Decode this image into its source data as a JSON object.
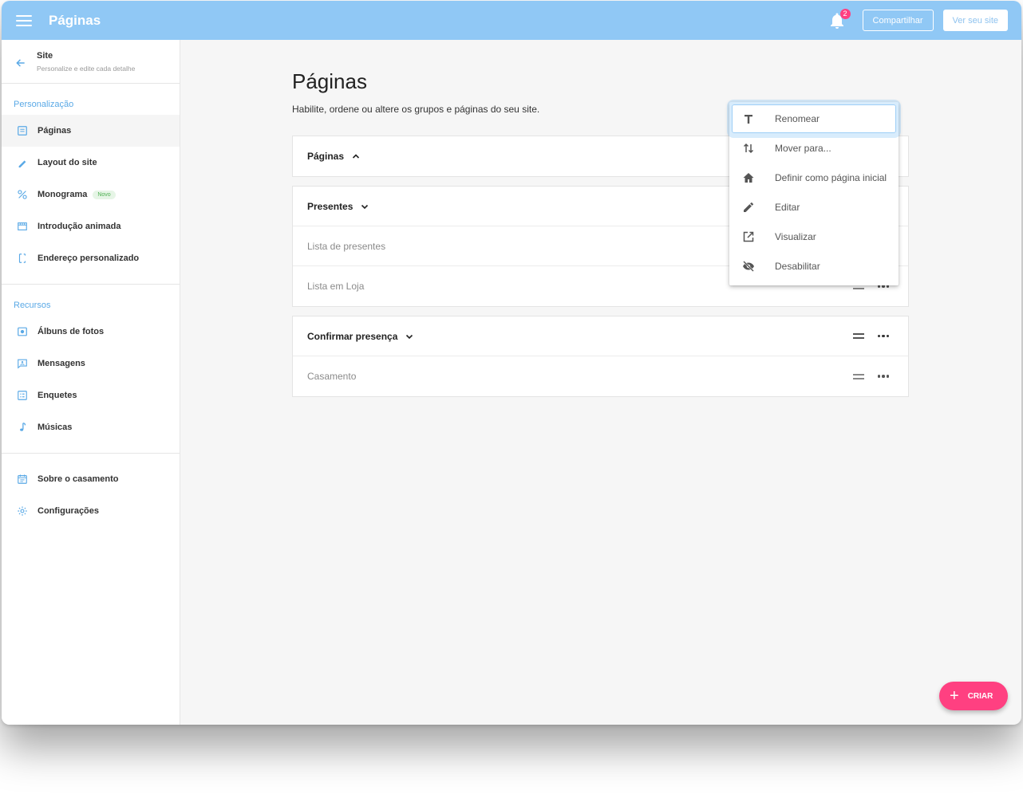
{
  "header": {
    "title": "Páginas",
    "notification_count": "2",
    "share_label": "Compartilhar",
    "view_site_label": "Ver seu site"
  },
  "sidebar": {
    "header_title": "Site",
    "header_subtitle": "Personalize e edite cada detalhe",
    "section_personalization": "Personalização",
    "personalization_items": [
      {
        "label": "Páginas",
        "icon": "page-icon"
      },
      {
        "label": "Layout do site",
        "icon": "brush-icon"
      },
      {
        "label": "Monograma",
        "icon": "monogram-icon",
        "badge": "Novo"
      },
      {
        "label": "Introdução animada",
        "icon": "film-icon"
      },
      {
        "label": "Endereço personalizado",
        "icon": "address-icon"
      }
    ],
    "section_resources": "Recursos",
    "resource_items": [
      {
        "label": "Álbuns de fotos",
        "icon": "photo-album-icon"
      },
      {
        "label": "Mensagens",
        "icon": "message-icon"
      },
      {
        "label": "Enquetes",
        "icon": "poll-icon"
      },
      {
        "label": "Músicas",
        "icon": "music-icon"
      }
    ],
    "bottom_items": [
      {
        "label": "Sobre o casamento",
        "icon": "calendar-icon"
      },
      {
        "label": "Configurações",
        "icon": "gear-icon"
      }
    ]
  },
  "main": {
    "title": "Páginas",
    "description": "Habilite, ordene ou altere os grupos e páginas do seu site.",
    "groups": [
      {
        "title": "Páginas",
        "expanded": true,
        "pages": []
      },
      {
        "title": "Presentes",
        "expanded": false,
        "pages": [
          "Lista de presentes",
          "Lista em Loja"
        ]
      },
      {
        "title": "Confirmar presença",
        "expanded": false,
        "pages": [
          "Casamento"
        ]
      }
    ]
  },
  "context_menu": {
    "items": [
      {
        "label": "Renomear",
        "icon": "text-icon"
      },
      {
        "label": "Mover para...",
        "icon": "swap-vertical-icon"
      },
      {
        "label": "Definir como página inicial",
        "icon": "home-icon"
      },
      {
        "label": "Editar",
        "icon": "pencil-icon"
      },
      {
        "label": "Visualizar",
        "icon": "open-external-icon"
      },
      {
        "label": "Desabilitar",
        "icon": "eye-off-icon"
      }
    ]
  },
  "fab": {
    "label": "CRIAR"
  },
  "colors": {
    "header": "#90c8f5",
    "accent": "#5aa9e6",
    "fab": "#ff4081"
  }
}
